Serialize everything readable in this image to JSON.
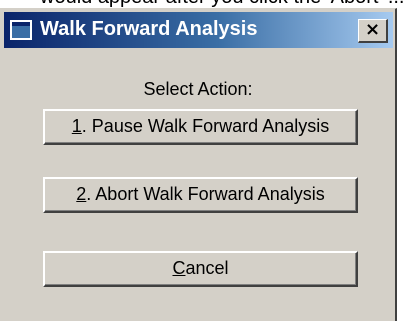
{
  "background_caption": "would appear after you click the 'Abort' ...",
  "window": {
    "title": "Walk Forward Analysis",
    "icon": "window-app-icon",
    "close_glyph": "×"
  },
  "prompt": "Select Action:",
  "buttons": {
    "pause": {
      "mnemonic": "1",
      "rest": ". Pause Walk Forward Analysis"
    },
    "abort": {
      "mnemonic": "2",
      "rest": ". Abort Walk Forward Analysis"
    },
    "cancel": {
      "mnemonic": "C",
      "rest": "ancel"
    }
  },
  "colors": {
    "face": "#d4d0c8",
    "title_start": "#0a246a",
    "title_end": "#a6caf0"
  }
}
